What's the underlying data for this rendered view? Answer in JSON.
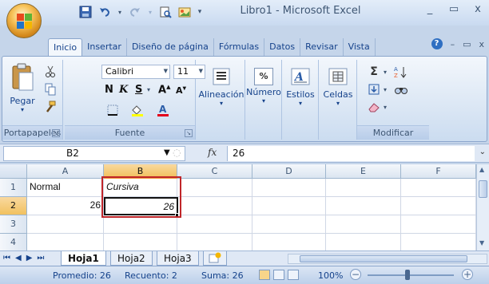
{
  "window": {
    "title": "Libro1 - Microsoft Excel",
    "minimize": "_",
    "restore": "▭",
    "close": "x"
  },
  "tabs": [
    {
      "label": "Inicio",
      "active": true
    },
    {
      "label": "Insertar"
    },
    {
      "label": "Diseño de página"
    },
    {
      "label": "Fórmulas"
    },
    {
      "label": "Datos"
    },
    {
      "label": "Revisar"
    },
    {
      "label": "Vista"
    }
  ],
  "ribbon": {
    "clipboard": {
      "paste": "Pegar",
      "label": "Portapapeles"
    },
    "font": {
      "name": "Calibri",
      "size": "11",
      "bold": "N",
      "italic": "K",
      "underline": "S",
      "label": "Fuente"
    },
    "alignment": {
      "label": "Alineación"
    },
    "number": {
      "label": "Número",
      "symbol": "%"
    },
    "styles": {
      "label": "Estilos"
    },
    "cells": {
      "label": "Celdas"
    },
    "editing": {
      "label": "Modificar",
      "sigma": "Σ"
    }
  },
  "formula_bar": {
    "name_box": "B2",
    "fx": "fx",
    "value": "26"
  },
  "grid": {
    "columns": [
      "A",
      "B",
      "C",
      "D",
      "E",
      "F"
    ],
    "selected_column": "B",
    "rows": [
      "1",
      "2",
      "3",
      "4"
    ],
    "selected_row": "2",
    "cells": {
      "A1": "Normal",
      "B1": "Cursiva",
      "A2": "26",
      "B2": "26"
    },
    "active_cell": "B2"
  },
  "sheets": [
    {
      "label": "Hoja1",
      "active": true
    },
    {
      "label": "Hoja2"
    },
    {
      "label": "Hoja3"
    }
  ],
  "status": {
    "average": "Promedio: 26",
    "count": "Recuento: 2",
    "sum": "Suma: 26",
    "zoom": "100%",
    "zoom_level_percent": 100
  },
  "colors": {
    "accent": "#15428b",
    "selection": "#f1c15f",
    "highlight_box": "#c0262a"
  }
}
